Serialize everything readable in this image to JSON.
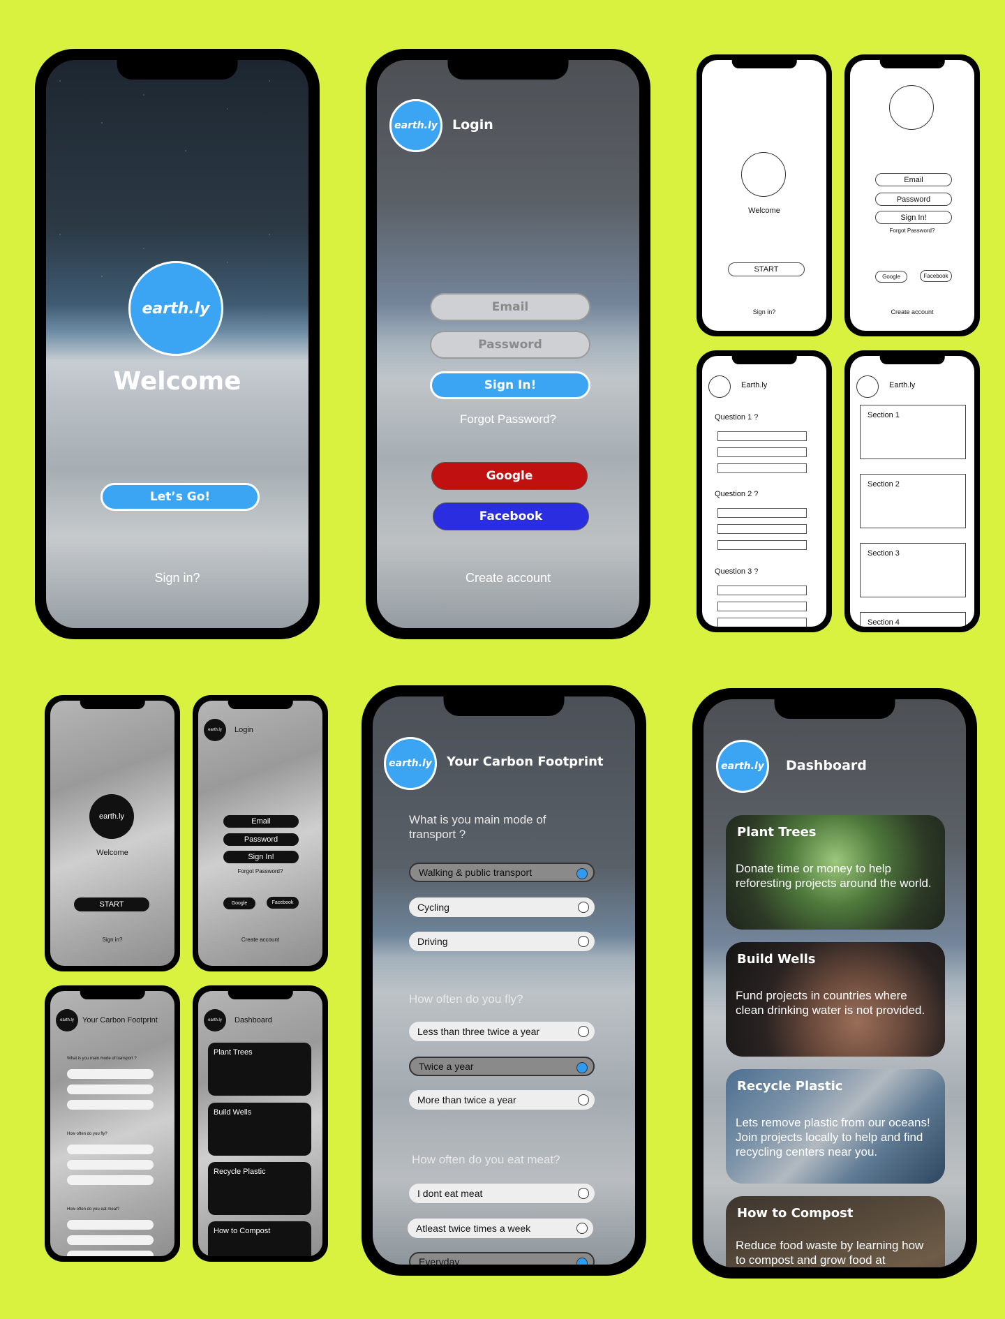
{
  "brand": {
    "logo": "earth.ly",
    "accent": "#3ba5f3",
    "background": "#d9f240"
  },
  "welcome": {
    "title": "Welcome",
    "cta": "Let’s Go!",
    "signin": "Sign in?"
  },
  "login": {
    "title": "Login",
    "email_placeholder": "Email",
    "password_placeholder": "Password",
    "signin": "Sign In!",
    "forgot": "Forgot Password?",
    "google": "Google",
    "facebook": "Facebook",
    "create": "Create account"
  },
  "wire_welcome": {
    "title": "Welcome",
    "start": "START",
    "signin": "Sign in?"
  },
  "wire_login": {
    "email": "Email",
    "password": "Password",
    "signin": "Sign In!",
    "forgot": "Forgot Password?",
    "google": "Google",
    "facebook": "Facebook",
    "create": "Create account"
  },
  "wire_quiz": {
    "title": "Earth.ly",
    "q1": "Question 1 ?",
    "q2": "Question 2 ?",
    "q3": "Question 3 ?"
  },
  "wire_dash": {
    "title": "Earth.ly",
    "s1": "Section 1",
    "s2": "Section 2",
    "s3": "Section 3",
    "s4": "Section 4"
  },
  "gray_welcome": {
    "logo": "earth.ly",
    "title": "Welcome",
    "start": "START",
    "signin": "Sign in?"
  },
  "gray_login": {
    "logo": "earth.ly",
    "title": "Login",
    "email": "Email",
    "password": "Password",
    "signin": "Sign In!",
    "forgot": "Forgot Password?",
    "google": "Google",
    "facebook": "Facebook",
    "create": "Create account"
  },
  "gray_quiz": {
    "logo": "earth.ly",
    "title": "Your Carbon Footprint",
    "q1": "What is you main mode of transport ?",
    "q2": "How often do you fly?",
    "q3": "How often do you eat meat?"
  },
  "gray_dash": {
    "logo": "earth.ly",
    "title": "Dashboard",
    "c1": "Plant Trees",
    "c2": "Build Wells",
    "c3": "Recycle Plastic",
    "c4": "How to Compost"
  },
  "quiz": {
    "title": "Your Carbon Footprint",
    "q1": "What is you main mode of transport ?",
    "q1_options": [
      "Walking & public transport",
      "Cycling",
      "Driving"
    ],
    "q2": "How often do you fly?",
    "q2_options": [
      "Less than three twice a year",
      "Twice a year",
      "More than twice a year"
    ],
    "q3": "How often do you eat meat?",
    "q3_options": [
      "I dont eat meat",
      "Atleast twice times a week",
      "Everyday"
    ]
  },
  "dashboard": {
    "title": "Dashboard",
    "cards": [
      {
        "title": "Plant Trees",
        "text": "Donate time or money to help reforesting projects around the world."
      },
      {
        "title": "Build Wells",
        "text": "Fund projects in countries where clean drinking water is not provided."
      },
      {
        "title": "Recycle Plastic",
        "text": "Lets remove plastic from our oceans! Join projects locally to help and find recycling centers near you."
      },
      {
        "title": "How to Compost",
        "text": "Reduce food waste by learning how to compost and grow food at"
      }
    ]
  }
}
